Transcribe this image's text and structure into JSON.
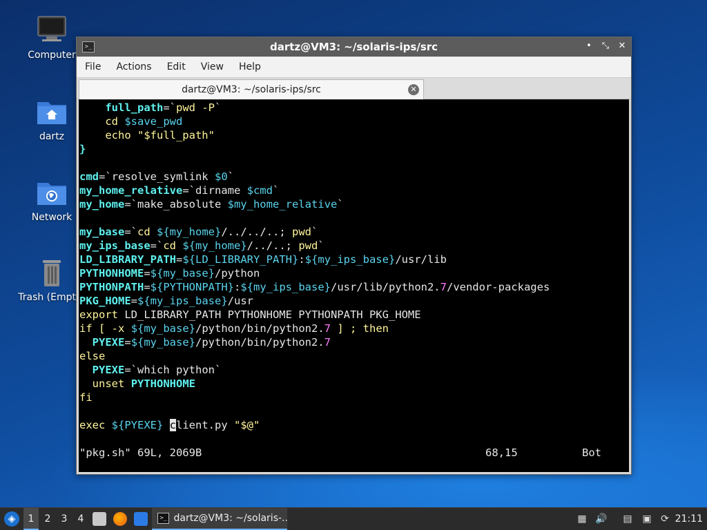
{
  "desktop": {
    "icons": [
      {
        "label": "Computer",
        "icon": "computer-icon"
      },
      {
        "label": "dartz",
        "icon": "home-folder-icon"
      },
      {
        "label": "Network",
        "icon": "network-folder-icon"
      },
      {
        "label": "Trash (Empty)",
        "icon": "trash-icon"
      }
    ]
  },
  "window": {
    "title": "dartz@VM3: ~/solaris-ips/src",
    "controls": {
      "minimize": "•",
      "maximize": "⤡",
      "close": "✕"
    },
    "menu": [
      "File",
      "Edit",
      "View",
      "Help",
      "Actions"
    ],
    "menu_items": {
      "file": "File",
      "actions": "Actions",
      "edit": "Edit",
      "view": "View",
      "help": "Help"
    },
    "tab_label": "dartz@VM3: ~/solaris-ips/src"
  },
  "terminal": {
    "lines": {
      "l01_a": "    ",
      "l01_b": "full_path",
      "l01_c": "=`",
      "l01_d": "pwd -P",
      "l01_e": "`",
      "l02_a": "    ",
      "l02_b": "cd",
      "l02_c": " $save_pwd",
      "l03_a": "    ",
      "l03_b": "echo",
      "l03_c": " \"$full_path\"",
      "l04": "}",
      "l06_a": "cmd",
      "l06_b": "=`resolve_symlink ",
      "l06_c": "$0",
      "l06_d": "`",
      "l07_a": "my_home_relative",
      "l07_b": "=`dirname ",
      "l07_c": "$cmd",
      "l07_d": "`",
      "l08_a": "my_home",
      "l08_b": "=`make_absolute ",
      "l08_c": "$my_home_relative",
      "l08_d": "`",
      "l10_a": "my_base",
      "l10_b": "=`",
      "l10_c": "cd ",
      "l10_d": "${my_home}",
      "l10_e": "/../../..; ",
      "l10_f": "pwd",
      "l10_g": "`",
      "l11_a": "my_ips_base",
      "l11_b": "=`",
      "l11_c": "cd ",
      "l11_d": "${my_home}",
      "l11_e": "/../..; ",
      "l11_f": "pwd",
      "l11_g": "`",
      "l12_a": "LD_LIBRARY_PATH",
      "l12_b": "=",
      "l12_c": "${LD_LIBRARY_PATH}",
      "l12_d": ":",
      "l12_e": "${my_ips_base}",
      "l12_f": "/usr/lib",
      "l13_a": "PYTHONHOME",
      "l13_b": "=",
      "l13_c": "${my_base}",
      "l13_d": "/python",
      "l14_a": "PYTHONPATH",
      "l14_b": "=",
      "l14_c": "${PYTHONPATH}",
      "l14_d": ":",
      "l14_e": "${my_ips_base}",
      "l14_f": "/usr/lib/python2.",
      "l14_g": "7",
      "l14_h": "/vendor-packages",
      "l15_a": "PKG_HOME",
      "l15_b": "=",
      "l15_c": "${my_ips_base}",
      "l15_d": "/usr",
      "l16_a": "export",
      "l16_b": " LD_LIBRARY_PATH PYTHONHOME PYTHONPATH PKG_HOME",
      "l17_a": "if",
      "l17_b": " [ ",
      "l17_c": "-x",
      "l17_d": " ",
      "l17_e": "${my_base}",
      "l17_f": "/python/bin/python2.",
      "l17_g": "7",
      "l17_h": " ] ; ",
      "l17_i": "then",
      "l18_a": "  ",
      "l18_b": "PYEXE",
      "l18_c": "=",
      "l18_d": "${my_base}",
      "l18_e": "/python/bin/python2.",
      "l18_f": "7",
      "l19": "else",
      "l20_a": "  ",
      "l20_b": "PYEXE",
      "l20_c": "=`which python`",
      "l21_a": "  ",
      "l21_b": "unset",
      "l21_c": " ",
      "l21_d": "PYTHONHOME",
      "l22": "fi",
      "l24_a": "exec",
      "l24_b": " ",
      "l24_c": "${PYEXE}",
      "l24_d": " ",
      "l24_e": "c",
      "l24_f": "lient.py ",
      "l24_g": "\"$@\""
    },
    "status": {
      "file": "\"pkg.sh\" 69L, 2069B",
      "position": "68,15",
      "scroll": "Bot"
    }
  },
  "taskbar": {
    "workspaces": [
      "1",
      "2",
      "3",
      "4"
    ],
    "active_workspace": "1",
    "task_label": "dartz@VM3: ~/solaris-...",
    "clock": "21:11"
  },
  "colors": {
    "accent": "#6ab0ff",
    "terminal_bg": "#000000",
    "title_bg": "#5c5c5c"
  }
}
